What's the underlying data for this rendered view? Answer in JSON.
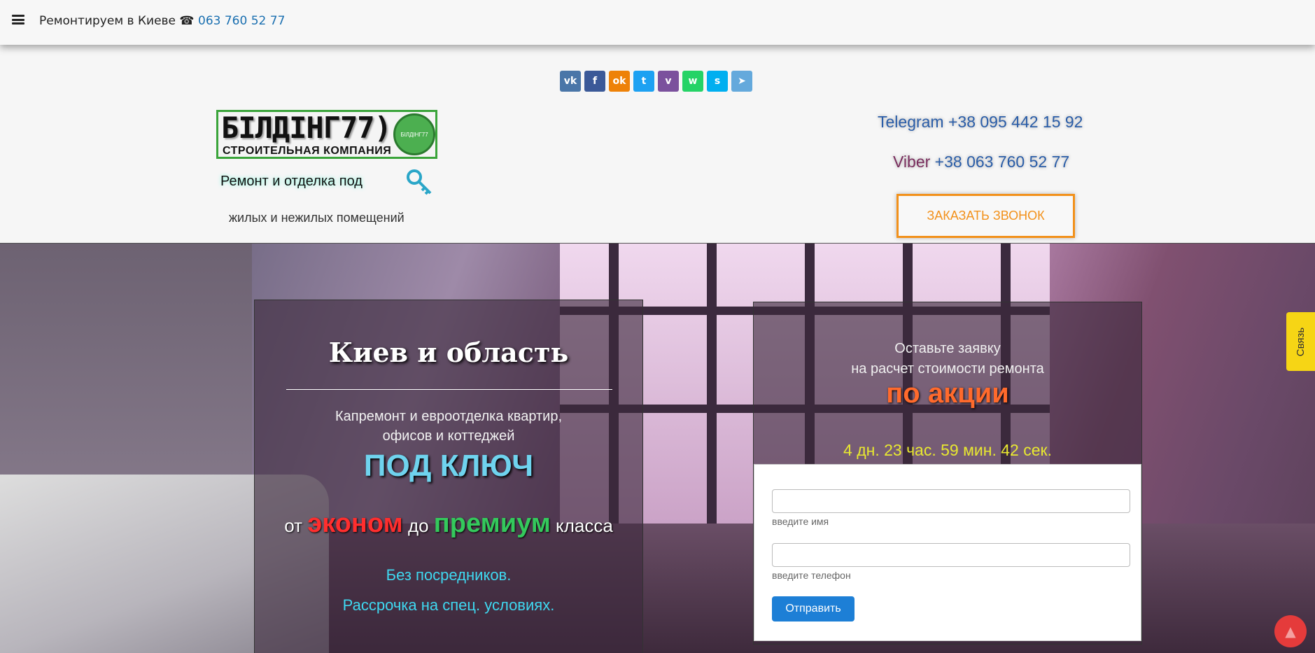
{
  "topbar": {
    "title": "Ремонтируем в Киеве ☎ ",
    "phone": "063 760 52 77"
  },
  "social": [
    {
      "name": "vk",
      "glyph": "vk",
      "color": "#4a76a8"
    },
    {
      "name": "facebook",
      "glyph": "f",
      "color": "#3b5998"
    },
    {
      "name": "odnoklassniki",
      "glyph": "ok",
      "color": "#ee8208"
    },
    {
      "name": "twitter",
      "glyph": "t",
      "color": "#1da1f2"
    },
    {
      "name": "viber",
      "glyph": "v",
      "color": "#7b519d"
    },
    {
      "name": "whatsapp",
      "glyph": "w",
      "color": "#25d366"
    },
    {
      "name": "skype",
      "glyph": "s",
      "color": "#00aff0"
    },
    {
      "name": "telegram",
      "glyph": "➤",
      "color": "#64a9dc"
    }
  ],
  "logo": {
    "main": "БІЛДІНГ77)",
    "sub": "СТРОИТЕЛЬНАЯ  КОМПАНИЯ",
    "badge": "БІЛДІНГ77"
  },
  "slogan": {
    "line1": "Ремонт и отделка под",
    "line2": "жилых и нежилых помещений"
  },
  "contacts": {
    "telegram": "Telegram +38 095 442 15 92",
    "viber_label": "Viber",
    "viber_number": " +38 063 760 52 77",
    "call_button": "ЗАКАЗАТЬ ЗВОНОК"
  },
  "left_panel": {
    "title": "Киев и область",
    "line1": "Капремонт и евроотделка квартир,",
    "line2": "офисов и коттеджей",
    "turnkey": "ПОД КЛЮЧ",
    "from": "от ",
    "econom": "эконом",
    "to": " до ",
    "premium": "премиум",
    "class": " класса",
    "no_middlemen": "Без посредников.",
    "installment": "Рассрочка на спец. условиях."
  },
  "right_panel": {
    "line1": "Оставьте заявку",
    "line2": "на расчет стоимости ремонта",
    "promo": "по акции",
    "countdown": "4 дн. 23 час. 59 мин. 42 сек."
  },
  "form": {
    "name_hint": "введите имя",
    "phone_hint": "введите телефон",
    "name_value": "",
    "phone_value": "",
    "submit": "Отправить"
  },
  "side_tab": "Связь"
}
